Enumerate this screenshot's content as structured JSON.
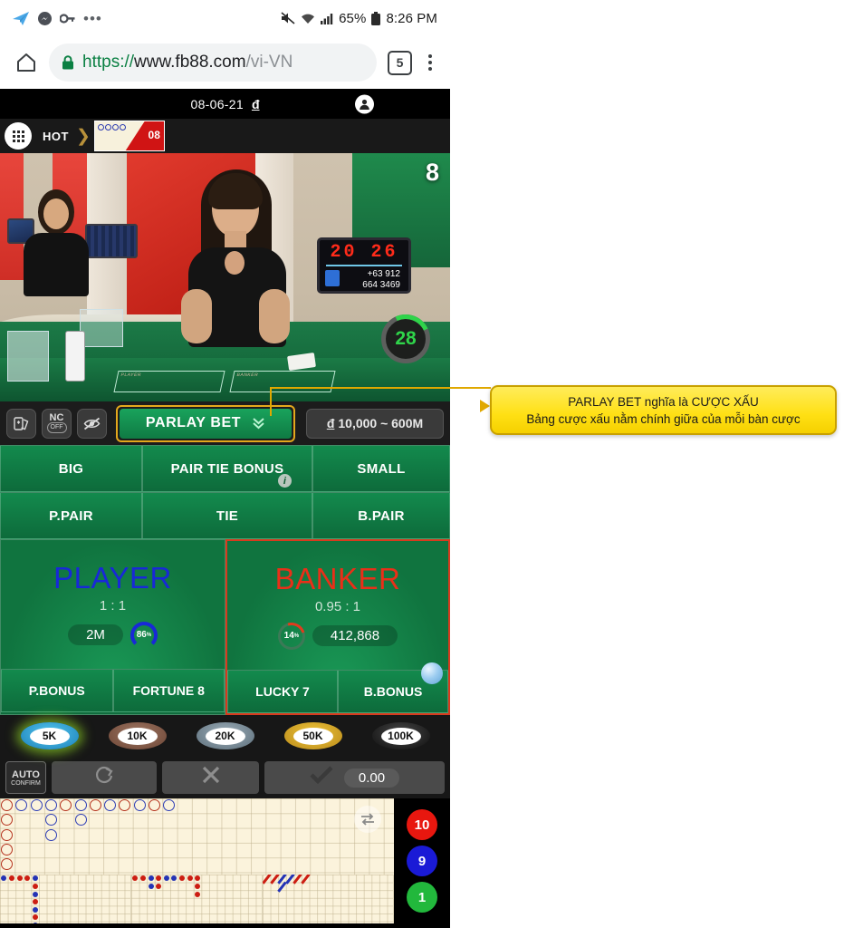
{
  "status_bar": {
    "icons": [
      "telegram-icon",
      "messenger-icon",
      "vpn-key-icon",
      "more-dots-icon",
      "mute-icon",
      "wifi-icon",
      "signal-icon"
    ],
    "battery_percent": "65%",
    "time": "8:26 PM"
  },
  "browser": {
    "home_icon": "home-icon",
    "url_secure_prefix": "https://",
    "url_domain": "www.fb88.com",
    "url_path": "/vi-VN",
    "lock_icon": "lock-icon",
    "tab_count": "5",
    "menu_icon": "kebab-menu-icon"
  },
  "game_header": {
    "date": "08-06-21",
    "currency": "đ",
    "account_icon": "account-avatar-icon"
  },
  "tab_strip": {
    "grid_icon": "apps-grid-icon",
    "hot_label": "HOT",
    "table_badge": "08"
  },
  "video": {
    "table_number": "8",
    "countdown": "28",
    "display_sign": {
      "numbers": "20  26",
      "phone_line1": "+63 912",
      "phone_line2": "664 3469"
    }
  },
  "control_bar": {
    "squeeze_icon": "card-squeeze-icon",
    "no_commission_label": "NC",
    "no_commission_state": "OFF",
    "hide_icon": "eye-off-icon",
    "parlay_label": "PARLAY BET",
    "parlay_chevron": "chevron-double-down-icon",
    "limit_currency": "đ",
    "limit_range": "10,000 ~ 600M"
  },
  "bet_grid": {
    "row1": [
      "BIG",
      "PAIR TIE BONUS",
      "SMALL"
    ],
    "row1_info_icon": "info-icon",
    "row2": [
      "P.PAIR",
      "TIE",
      "B.PAIR"
    ],
    "player": {
      "title": "PLAYER",
      "odds": "1 : 1",
      "amount": "2M",
      "percent": "86",
      "percent_suffix": "%",
      "color": "#1828d8"
    },
    "banker": {
      "title": "BANKER",
      "odds": "0.95 : 1",
      "amount": "412,868",
      "percent": "14",
      "percent_suffix": "%",
      "color": "#ea2f18"
    },
    "sub_row": [
      "P.BONUS",
      "FORTUNE 8",
      "LUCKY 7",
      "B.BONUS"
    ]
  },
  "chips": [
    {
      "label": "5K",
      "selected": true
    },
    {
      "label": "10K",
      "selected": false
    },
    {
      "label": "20K",
      "selected": false
    },
    {
      "label": "50K",
      "selected": false
    },
    {
      "label": "100K",
      "selected": false
    }
  ],
  "actions": {
    "auto_line1": "AUTO",
    "auto_line2": "CONFIRM",
    "redo_icon": "redo-icon",
    "clear_icon": "clear-x-icon",
    "confirm_icon": "check-icon",
    "confirm_amount": "0.00"
  },
  "roadmap": {
    "swap_icon": "swap-roads-icon",
    "predictions": [
      {
        "label": "10",
        "color": "#e8170f"
      },
      {
        "label": "9",
        "color": "#1a1ad6"
      },
      {
        "label": "1",
        "color": "#22b83c"
      }
    ],
    "big_road": [
      {
        "col": 0,
        "row": 0,
        "side": "r"
      },
      {
        "col": 0,
        "row": 1,
        "side": "r"
      },
      {
        "col": 0,
        "row": 2,
        "side": "r"
      },
      {
        "col": 0,
        "row": 3,
        "side": "r"
      },
      {
        "col": 0,
        "row": 4,
        "side": "r"
      },
      {
        "col": 1,
        "row": 0,
        "side": "b"
      },
      {
        "col": 2,
        "row": 0,
        "side": "b"
      },
      {
        "col": 3,
        "row": 0,
        "side": "b"
      },
      {
        "col": 3,
        "row": 1,
        "side": "b"
      },
      {
        "col": 3,
        "row": 2,
        "side": "b"
      },
      {
        "col": 4,
        "row": 0,
        "side": "r"
      },
      {
        "col": 5,
        "row": 0,
        "side": "b"
      },
      {
        "col": 5,
        "row": 1,
        "side": "b"
      },
      {
        "col": 6,
        "row": 0,
        "side": "r"
      },
      {
        "col": 7,
        "row": 0,
        "side": "b"
      },
      {
        "col": 8,
        "row": 0,
        "side": "r"
      },
      {
        "col": 9,
        "row": 0,
        "side": "b"
      },
      {
        "col": 10,
        "row": 0,
        "side": "r"
      },
      {
        "col": 11,
        "row": 0,
        "side": "b"
      }
    ],
    "big_eye_road": [
      {
        "col": 0,
        "row": 0,
        "side": "b"
      },
      {
        "col": 1,
        "row": 0,
        "side": "r"
      },
      {
        "col": 2,
        "row": 0,
        "side": "r"
      },
      {
        "col": 3,
        "row": 0,
        "side": "r"
      },
      {
        "col": 4,
        "row": 0,
        "side": "b"
      },
      {
        "col": 4,
        "row": 1,
        "side": "r"
      },
      {
        "col": 4,
        "row": 2,
        "side": "b"
      },
      {
        "col": 4,
        "row": 3,
        "side": "r"
      },
      {
        "col": 4,
        "row": 4,
        "side": "b"
      },
      {
        "col": 4,
        "row": 5,
        "side": "r"
      },
      {
        "col": 4,
        "row": 6,
        "side": "b"
      }
    ],
    "small_road": [
      {
        "col": 0,
        "row": 0,
        "side": "r"
      },
      {
        "col": 1,
        "row": 0,
        "side": "r"
      },
      {
        "col": 2,
        "row": 0,
        "side": "b"
      },
      {
        "col": 2,
        "row": 1,
        "side": "b"
      },
      {
        "col": 3,
        "row": 0,
        "side": "r"
      },
      {
        "col": 3,
        "row": 1,
        "side": "r"
      },
      {
        "col": 4,
        "row": 0,
        "side": "b"
      },
      {
        "col": 5,
        "row": 0,
        "side": "b"
      },
      {
        "col": 6,
        "row": 0,
        "side": "r"
      },
      {
        "col": 7,
        "row": 0,
        "side": "r"
      },
      {
        "col": 8,
        "row": 0,
        "side": "r"
      },
      {
        "col": 8,
        "row": 1,
        "side": "r"
      },
      {
        "col": 8,
        "row": 2,
        "side": "r"
      }
    ],
    "cockroach_road": [
      {
        "col": 0,
        "row": 0,
        "side": "r"
      },
      {
        "col": 1,
        "row": 0,
        "side": "r"
      },
      {
        "col": 2,
        "row": 0,
        "side": "b"
      },
      {
        "col": 2,
        "row": 1,
        "side": "b"
      },
      {
        "col": 3,
        "row": 0,
        "side": "b"
      },
      {
        "col": 4,
        "row": 0,
        "side": "r"
      },
      {
        "col": 5,
        "row": 0,
        "side": "r"
      }
    ]
  },
  "callout": {
    "line1": "PARLAY BET nghĩa là CƯỢC XẤU",
    "line2": "Bảng cược xấu nằm chính giữa của mỗi bàn cược",
    "bg_color": "#ffe014",
    "border_color": "#c8a000"
  }
}
